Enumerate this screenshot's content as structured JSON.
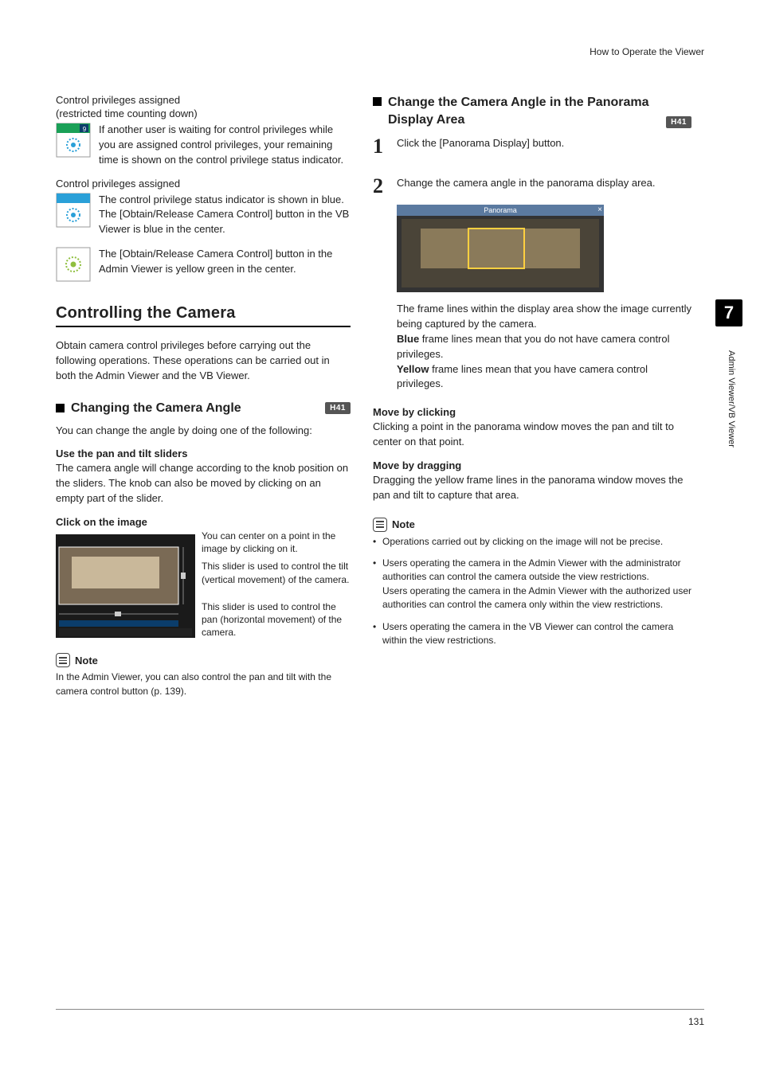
{
  "header": {
    "title": "How to Operate the Viewer"
  },
  "sidebar": {
    "chapter": "7",
    "label": "Admin Viewer/VB Viewer"
  },
  "page_number": "131",
  "left": {
    "sec1_title": "Control privileges assigned",
    "sec1_sub": "(restricted time counting down)",
    "sec1_body": "If another user is waiting for control privileges while you are assigned control privileges, your remaining time is shown on the control privilege status indicator.",
    "sec2_title": "Control privileges assigned",
    "sec2_body_a": "The control privilege status indicator is shown in blue.",
    "sec2_body_b": "The [Obtain/Release Camera Control] button in the VB Viewer is blue in the center.",
    "sec2_body_c": "The [Obtain/Release Camera Control] button in the Admin Viewer is yellow green in the center.",
    "h2": "Controlling the Camera",
    "h2_intro": "Obtain camera control privileges before carrying out the following operations. These operations can be carried out in both the Admin Viewer and the VB Viewer.",
    "h3_a": "Changing the Camera Angle",
    "tag_a": "H41",
    "h3_a_intro": "You can change the angle by doing one of the following:",
    "sub_a": "Use the pan and tilt sliders",
    "sub_a_body": "The camera angle will change according to the knob position on the sliders. The knob can also be moved by clicking on an empty part of the slider.",
    "sub_b": "Click on the image",
    "annot1": "You can center on a point in the image by clicking on it.",
    "annot2": "This slider is used to control the tilt (vertical movement) of the camera.",
    "annot3": "This slider is used to control the pan (horizontal movement) of the camera.",
    "note_label": "Note",
    "note_body": "In the Admin Viewer, you can also control the pan and tilt with the camera control button (p. 139)."
  },
  "right": {
    "h3_b": "Change the Camera Angle in the Panorama Display Area",
    "tag_b": "H41",
    "step1": "Click the [Panorama Display] button.",
    "step2": "Change the camera angle in the panorama display area.",
    "pano_title": "Panorama",
    "caption1": "The frame lines within the display area show the image currently being captured by the camera.",
    "caption2a": "Blue",
    "caption2b": " frame lines mean that you do not have camera control privileges.",
    "caption3a": "Yellow",
    "caption3b": " frame lines mean that you have camera control privileges.",
    "sub_c": "Move by clicking",
    "sub_c_body": "Clicking a point in the panorama window moves the pan and tilt to center on that point.",
    "sub_d": "Move by dragging",
    "sub_d_body": "Dragging the yellow frame lines in the panorama window moves the pan and tilt to capture that area.",
    "note_label": "Note",
    "bullet1": "Operations carried out by clicking on the image will not be precise.",
    "bullet2a": "Users operating the camera in the Admin Viewer with the administrator authorities can control the camera outside the view restrictions.",
    "bullet2b": "Users operating the camera in the Admin Viewer with the authorized user authorities can control the camera only within the view restrictions.",
    "bullet3": "Users operating the camera in the VB Viewer can control the camera within the view restrictions."
  }
}
